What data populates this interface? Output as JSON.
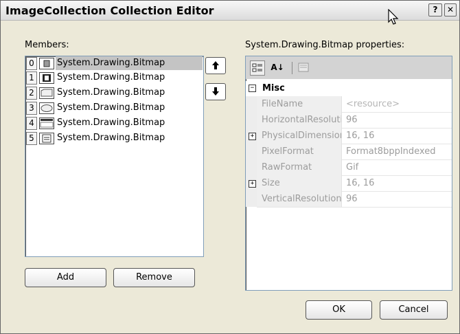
{
  "window": {
    "title": "ImageCollection Collection Editor",
    "help_glyph": "?",
    "close_glyph": "✕"
  },
  "members": {
    "label": "Members:",
    "items": [
      {
        "index": "0",
        "name": "System.Drawing.Bitmap",
        "selected": true
      },
      {
        "index": "1",
        "name": "System.Drawing.Bitmap",
        "selected": false
      },
      {
        "index": "2",
        "name": "System.Drawing.Bitmap",
        "selected": false
      },
      {
        "index": "3",
        "name": "System.Drawing.Bitmap",
        "selected": false
      },
      {
        "index": "4",
        "name": "System.Drawing.Bitmap",
        "selected": false
      },
      {
        "index": "5",
        "name": "System.Drawing.Bitmap",
        "selected": false
      }
    ],
    "move_up_glyph": "🡑",
    "move_down_glyph": "🡓",
    "add_label": "Add",
    "remove_label": "Remove"
  },
  "properties": {
    "label": "System.Drawing.Bitmap properties:",
    "toolbar": {
      "categorized_icon": "categorized-icon",
      "alphabetical_glyph": "A↓",
      "property_pages_icon": "property-pages-icon"
    },
    "category": {
      "expander": "⊟",
      "name": "Misc"
    },
    "rows": [
      {
        "name": "FileName",
        "value": "<resource>",
        "expandable": false,
        "value_dim": true
      },
      {
        "name": "HorizontalResolution",
        "value": "96",
        "expandable": false,
        "value_dim": false
      },
      {
        "name": "PhysicalDimension",
        "value": "16, 16",
        "expandable": true,
        "value_dim": false
      },
      {
        "name": "PixelFormat",
        "value": "Format8bppIndexed",
        "expandable": false,
        "value_dim": false
      },
      {
        "name": "RawFormat",
        "value": "Gif",
        "expandable": false,
        "value_dim": false
      },
      {
        "name": "Size",
        "value": "16, 16",
        "expandable": true,
        "value_dim": false
      },
      {
        "name": "VerticalResolution",
        "value": "96",
        "expandable": false,
        "value_dim": false
      }
    ]
  },
  "footer": {
    "ok_label": "OK",
    "cancel_label": "Cancel"
  }
}
